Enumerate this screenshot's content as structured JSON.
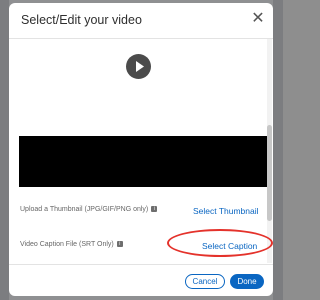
{
  "dialog": {
    "title": "Select/Edit your video",
    "close_icon": "close-icon"
  },
  "video": {
    "play_icon": "play-icon"
  },
  "thumbnail": {
    "label": "Upload a Thumbnail (JPG/GIF/PNG only)",
    "info_icon": "info-icon",
    "action": "Select Thumbnail"
  },
  "caption": {
    "label": "Video Caption File (SRT Only)",
    "info_icon": "info-icon",
    "action": "Select Caption",
    "highlight_color": "#e4322b"
  },
  "footer": {
    "cancel_label": "Cancel",
    "done_label": "Done"
  },
  "colors": {
    "accent": "#0a66c2"
  }
}
